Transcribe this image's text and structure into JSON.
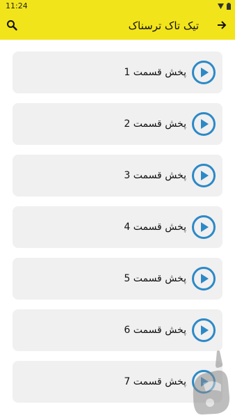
{
  "status": {
    "time": "11:24"
  },
  "header": {
    "title": "تیک تاک ترسناک",
    "back_icon": "arrow-right-icon",
    "search_icon": "search-icon"
  },
  "episodes": [
    {
      "label": "پخش قسمت 1"
    },
    {
      "label": "پخش قسمت 2"
    },
    {
      "label": "پخش قسمت 3"
    },
    {
      "label": "پخش قسمت 4"
    },
    {
      "label": "پخش قسمت 5"
    },
    {
      "label": "پخش قسمت 6"
    },
    {
      "label": "پخش قسمت 7"
    }
  ],
  "colors": {
    "accent": "#f2e41a",
    "play": "#2c89c7",
    "card": "#f0f0f0"
  }
}
